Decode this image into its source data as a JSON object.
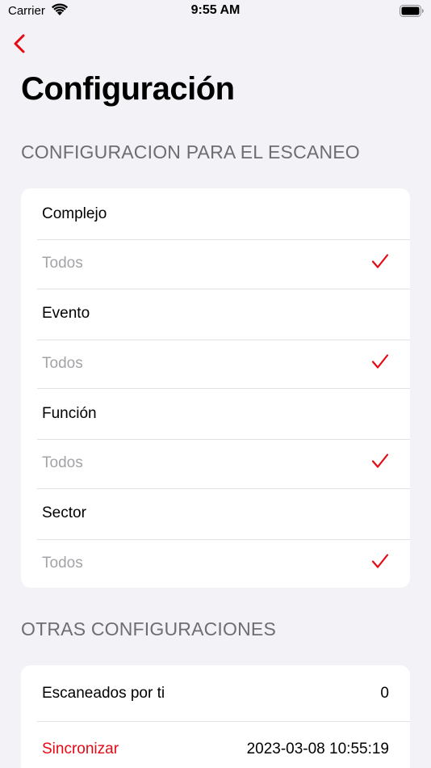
{
  "status_bar": {
    "carrier": "Carrier",
    "time": "9:55 AM",
    "wifi_icon": "wifi-icon",
    "battery_icon": "battery-icon"
  },
  "nav": {
    "back_icon": "chevron-left-icon",
    "title": "Configuración"
  },
  "accent_color": "#e50914",
  "scan_section": {
    "header": "CONFIGURACION PARA EL ESCANEO",
    "groups": [
      {
        "label": "Complejo",
        "selected": "Todos"
      },
      {
        "label": "Evento",
        "selected": "Todos"
      },
      {
        "label": "Función",
        "selected": "Todos"
      },
      {
        "label": "Sector",
        "selected": "Todos"
      }
    ]
  },
  "other_section": {
    "header": "OTRAS CONFIGURACIONES",
    "scanned_label": "Escaneados por ti",
    "scanned_value": "0",
    "sync_label": "Sincronizar",
    "sync_value": "2023-03-08 10:55:19"
  }
}
